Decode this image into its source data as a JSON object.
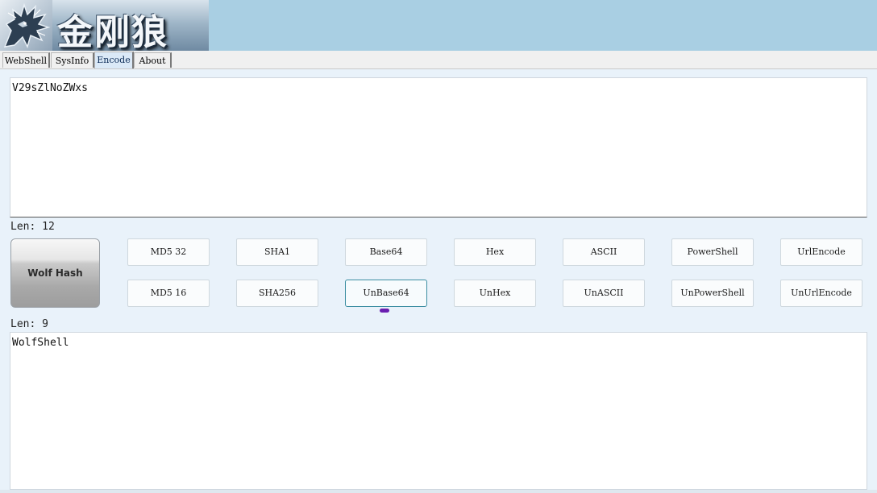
{
  "header": {
    "brand_text": "金刚狼"
  },
  "tabs": [
    {
      "label": "WebShell"
    },
    {
      "label": "SysInfo"
    },
    {
      "label": "Encode",
      "active": true
    },
    {
      "label": "About"
    }
  ],
  "input": {
    "value": "V29sZlNoZWxs",
    "len_label": "Len: 12"
  },
  "wolf_hash": {
    "label": "Wolf Hash"
  },
  "buttons_row1": [
    "MD5 32",
    "SHA1",
    "Base64",
    "Hex",
    "ASCII",
    "PowerShell",
    "UrlEncode"
  ],
  "buttons_row2": [
    "MD5 16",
    "SHA256",
    "UnBase64",
    "UnHex",
    "UnASCII",
    "UnPowerShell",
    "UnUrlEncode"
  ],
  "focused_button": "UnBase64",
  "output": {
    "len_label": "Len: 9",
    "value": "WolfShell"
  },
  "colors": {
    "banner": "#a9cfe3",
    "panel_bg": "#e9f2fa",
    "focus_border": "#3b8da1",
    "cursor": "#6a1fb0"
  }
}
